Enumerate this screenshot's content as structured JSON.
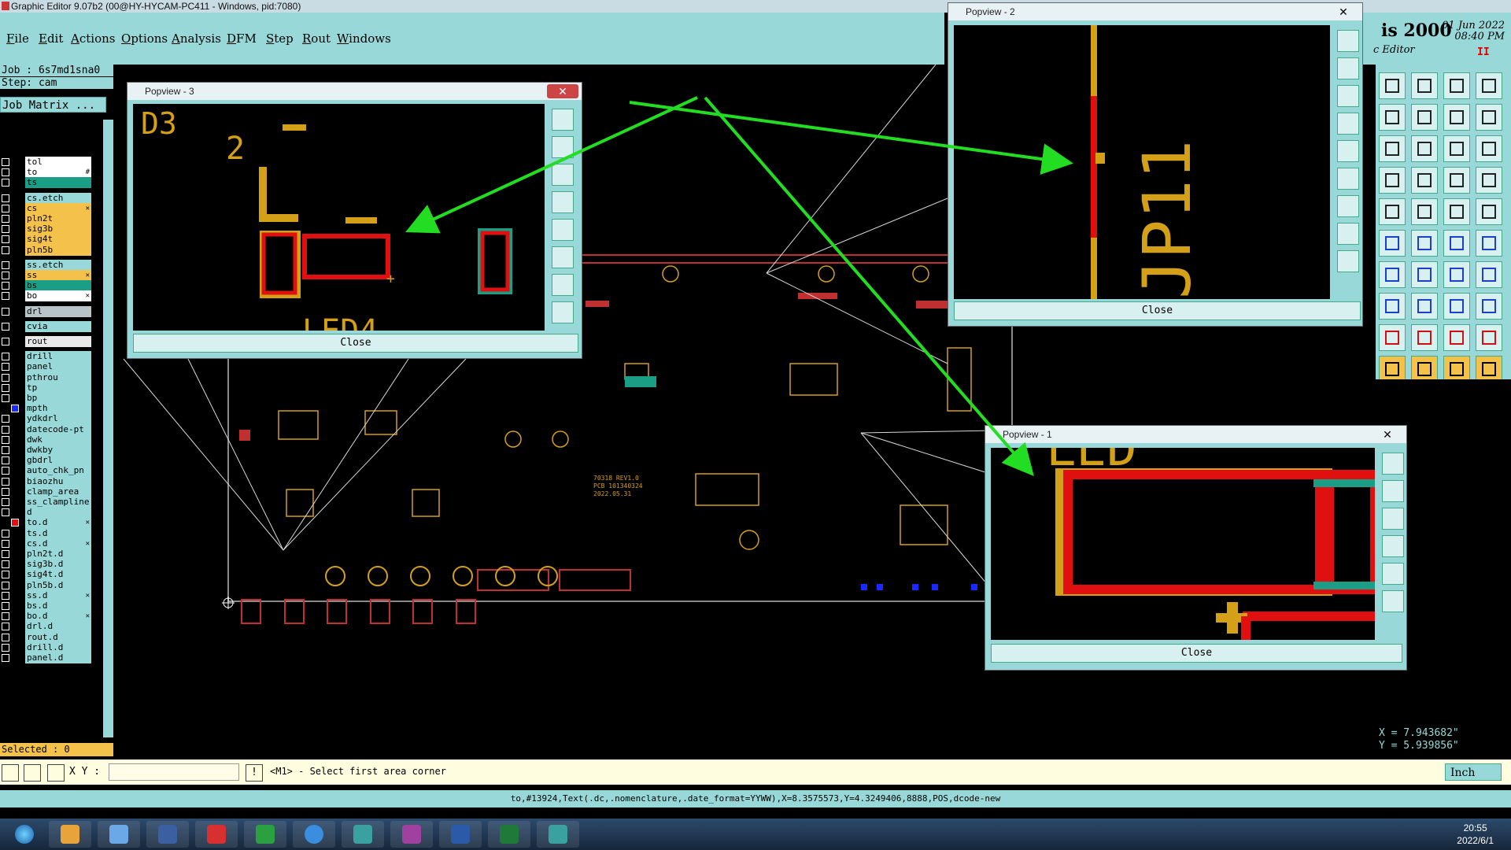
{
  "window": {
    "title": "Graphic Editor 9.07b2 (00@HY-HYCAM-PC411 - Windows, pid:7080)"
  },
  "menu": [
    "File",
    "Edit",
    "Actions",
    "Options",
    "Analysis",
    "DFM",
    "Step",
    "Rout",
    "Windows"
  ],
  "brand": {
    "name": "is 2000",
    "subtitle": "c Editor",
    "date": "01 Jun 2022",
    "time": "08:40 PM",
    "status_mark": "II"
  },
  "job": {
    "job_label": "Job : 6s7md1sna0",
    "step_label": "Step: cam",
    "matrix_button": "Job Matrix ..."
  },
  "layers": [
    {
      "name": "tol",
      "color": "#ffffff"
    },
    {
      "name": "to",
      "color": "#ffffff",
      "mark": "#"
    },
    {
      "name": "ts",
      "color": "#1a9e86"
    },
    {
      "name": "cs.etch",
      "color": "#98d8d8"
    },
    {
      "name": "cs",
      "color": "#f4c24a",
      "mark": "✕"
    },
    {
      "name": "pln2t",
      "color": "#f4c24a"
    },
    {
      "name": "sig3b",
      "color": "#f4c24a"
    },
    {
      "name": "sig4t",
      "color": "#f4c24a"
    },
    {
      "name": "pln5b",
      "color": "#f4c24a"
    },
    {
      "name": "ss.etch",
      "color": "#98d8d8"
    },
    {
      "name": "ss",
      "color": "#f4c24a",
      "mark": "✕"
    },
    {
      "name": "bs",
      "color": "#1a9e86"
    },
    {
      "name": "bo",
      "color": "#ffffff",
      "mark": "✕"
    },
    {
      "name": "drl",
      "color": "#b8c4c8"
    },
    {
      "name": "cvia",
      "color": "#98d8d8"
    },
    {
      "name": "rout",
      "color": "#e8e8e8"
    },
    {
      "name": "drill",
      "color": "#98d8d8"
    },
    {
      "name": "panel",
      "color": "#98d8d8"
    },
    {
      "name": "pthrou",
      "color": "#98d8d8"
    },
    {
      "name": "tp",
      "color": "#98d8d8"
    },
    {
      "name": "bp",
      "color": "#98d8d8"
    },
    {
      "name": "mpth",
      "color": "#98d8d8",
      "swatch": "#1a2aff"
    },
    {
      "name": "ydkdrl",
      "color": "#98d8d8"
    },
    {
      "name": "datecode-pt",
      "color": "#98d8d8"
    },
    {
      "name": "dwk",
      "color": "#98d8d8"
    },
    {
      "name": "dwkby",
      "color": "#98d8d8"
    },
    {
      "name": "gbdrl",
      "color": "#98d8d8"
    },
    {
      "name": "auto_chk_pn",
      "color": "#98d8d8"
    },
    {
      "name": "biaozhu",
      "color": "#98d8d8"
    },
    {
      "name": "clamp_area",
      "color": "#98d8d8"
    },
    {
      "name": "ss_clampline",
      "color": "#98d8d8"
    },
    {
      "name": "d",
      "color": "#98d8d8"
    },
    {
      "name": "to.d",
      "color": "#98d8d8",
      "swatch": "#e01010",
      "mark": "✕"
    },
    {
      "name": "ts.d",
      "color": "#98d8d8"
    },
    {
      "name": "cs.d",
      "color": "#98d8d8",
      "mark": "✕"
    },
    {
      "name": "pln2t.d",
      "color": "#98d8d8"
    },
    {
      "name": "sig3b.d",
      "color": "#98d8d8"
    },
    {
      "name": "sig4t.d",
      "color": "#98d8d8"
    },
    {
      "name": "pln5b.d",
      "color": "#98d8d8"
    },
    {
      "name": "ss.d",
      "color": "#98d8d8",
      "mark": "✕"
    },
    {
      "name": "bs.d",
      "color": "#98d8d8"
    },
    {
      "name": "bo.d",
      "color": "#98d8d8",
      "mark": "✕"
    },
    {
      "name": "drl.d",
      "color": "#98d8d8"
    },
    {
      "name": "rout.d",
      "color": "#98d8d8"
    },
    {
      "name": "drill.d",
      "color": "#98d8d8"
    },
    {
      "name": "panel.d",
      "color": "#98d8d8"
    }
  ],
  "selected_label": "Selected : 0",
  "popviews": [
    {
      "title": "Popview - 3",
      "close_label": "Close",
      "texts": [
        "D3",
        "2",
        "LED4"
      ]
    },
    {
      "title": "Popview - 2",
      "close_label": "Close",
      "texts": [
        "JP11"
      ]
    },
    {
      "title": "Popview - 1",
      "close_label": "Close",
      "texts": [
        "LED"
      ]
    }
  ],
  "board_texts": [
    "70318 REV1.0",
    "PCB 101340324",
    "2022.05.31"
  ],
  "coords": {
    "x": "X = 7.943682\"",
    "y": "Y = 5.939856\""
  },
  "command": {
    "xy_label": "X Y :",
    "input_value": "",
    "message": "<M1> - Select first area corner",
    "unit": "Inch"
  },
  "status_text": "to,#13924,Text(.dc,.nomenclature,.date_format=YYWW),X=8.3575573,Y=4.3249406,8888,POS,dcode-new",
  "clock": {
    "time": "20:55",
    "date": "2022/6/1"
  },
  "colors": {
    "panel": "#98d8d8",
    "pad_red": "#e01010",
    "silk_yellow": "#d4a018",
    "arrow_green": "#22dd22"
  }
}
